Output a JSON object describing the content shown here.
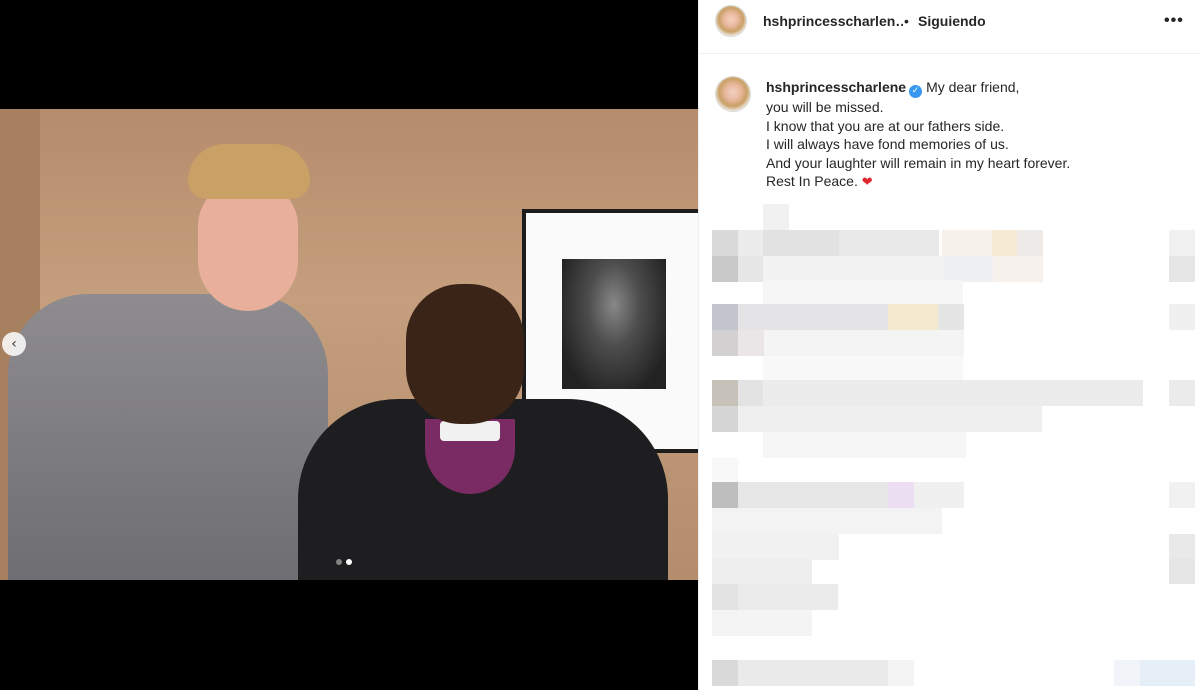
{
  "post": {
    "username": "hshprincesscharlene",
    "header_username": "hshprincesscharlen…",
    "separator": "•",
    "follow_label": "Siguiendo",
    "more_icon": "•••",
    "caption_lines": [
      "My dear friend,",
      "you will be missed.",
      "I know that you are at our fathers side.",
      "I will always have fond memories of us.",
      "And your laughter will remain in my heart forever.",
      "Rest In Peace."
    ],
    "heart": "❤"
  },
  "carousel": {
    "prev_icon": "‹",
    "total": 2,
    "active_index": 2
  },
  "colors": {
    "accent": "#3897f0",
    "heart": "#e0252f",
    "text": "#262626"
  }
}
